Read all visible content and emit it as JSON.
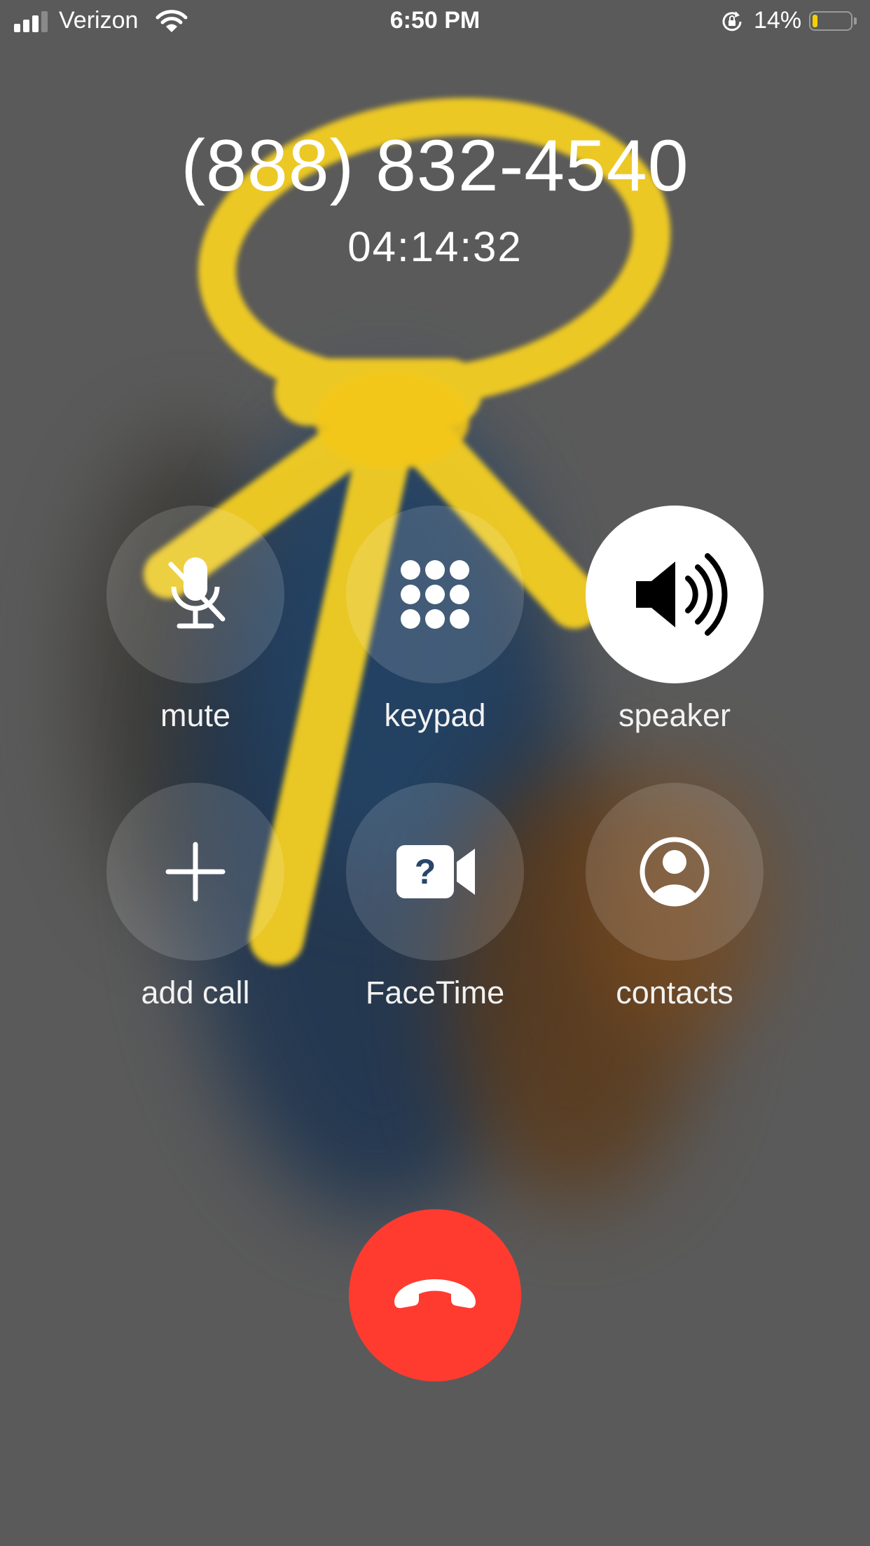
{
  "status_bar": {
    "carrier": "Verizon",
    "time": "6:50 PM",
    "battery_percent": "14%",
    "battery_level": 0.14,
    "icons": [
      "signal-icon",
      "wifi-icon",
      "rotation-lock-icon",
      "battery-icon"
    ]
  },
  "call": {
    "number": "(888) 832-4540",
    "duration": "04:14:32"
  },
  "controls": {
    "mute": "mute",
    "keypad": "keypad",
    "speaker": "speaker",
    "add_call": "add call",
    "facetime": "FaceTime",
    "contacts": "contacts"
  },
  "state": {
    "speaker_active": true
  },
  "colors": {
    "background": "#5a5a5a",
    "end_call": "#ff3b30",
    "battery_low": "#f6d100",
    "ribbon": "#f7d21e"
  }
}
